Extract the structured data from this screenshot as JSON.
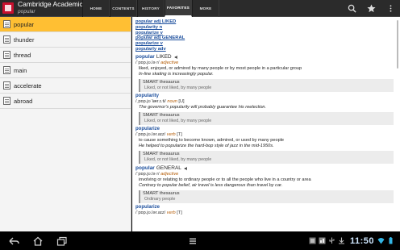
{
  "app": {
    "title": "Cambridge Academic",
    "subtitle": "popular",
    "brand_color": "#c8102e"
  },
  "tabs": [
    {
      "label": "HOME",
      "active": false
    },
    {
      "label": "CONTENTS",
      "active": false
    },
    {
      "label": "HISTORY",
      "active": false
    },
    {
      "label": "FAVORITES",
      "active": true
    },
    {
      "label": "MORE",
      "active": false
    }
  ],
  "actionbar_icons": [
    "search-icon",
    "star-icon",
    "overflow-menu-icon"
  ],
  "history": {
    "items": [
      {
        "label": "popular",
        "selected": true
      },
      {
        "label": "thunder",
        "selected": false
      },
      {
        "label": "thread",
        "selected": false
      },
      {
        "label": "main",
        "selected": false
      },
      {
        "label": "accelerate",
        "selected": false
      },
      {
        "label": "abroad",
        "selected": false
      }
    ],
    "highlight_color": "#ffbf33"
  },
  "entry": {
    "links": [
      "popular adj LIKED",
      "popularity n",
      "popularize v",
      "popular adj GENERAL",
      "popularize v",
      "popularly adv"
    ],
    "sense1": {
      "headword": "popular",
      "level": "LIKED",
      "pron": "/ˈpɒp.jʊ.lə r/",
      "pos": "adjective",
      "definition": "liked, enjoyed, or admired by many people or by most people in a particular group",
      "example": "In-line skating is increasingly popular.",
      "thesaurus_title": "SMART thesaurus",
      "thesaurus_body": "Liked, or not liked, by many people"
    },
    "popularity": {
      "headword": "popularity",
      "pron": "/ˌpɒp.jʊˈlær.ɪ.ti/",
      "pos": "noun",
      "grammar": "[U]",
      "example": "The governor's popularity will probably guarantee his reelection.",
      "thesaurus_title": "SMART thesaurus",
      "thesaurus_body": "Liked, or not liked, by many people"
    },
    "popularize1": {
      "headword": "popularize",
      "pron": "/ˈpɒp.jʊ.lər.aɪz/",
      "pos": "verb",
      "grammar": "[T]",
      "definition": "to cause something to become known, admired, or used by many people",
      "example": "He helped to popularize the hard-bop style of jazz in the mid-1950s.",
      "thesaurus_title": "SMART thesaurus",
      "thesaurus_body": "Liked, or not liked, by many people"
    },
    "sense2": {
      "headword": "popular",
      "level": "GENERAL",
      "pron": "/ˈpɒp.jʊ.lə r/",
      "pos": "adjective",
      "definition": "involving or relating to ordinary people or to all the people who live in a country or area",
      "example": "Contrary to popular belief, air travel is less dangerous than travel by car.",
      "thesaurus_title": "SMART thesaurus",
      "thesaurus_body": "Ordinary people"
    },
    "popularize2": {
      "headword": "popularize",
      "pron": "/ˈpɒp.jʊ.lər.aɪz/",
      "pos": "verb",
      "grammar": "[T]"
    }
  },
  "system": {
    "clock": "11:50",
    "clock_color": "#cfe7ff"
  }
}
